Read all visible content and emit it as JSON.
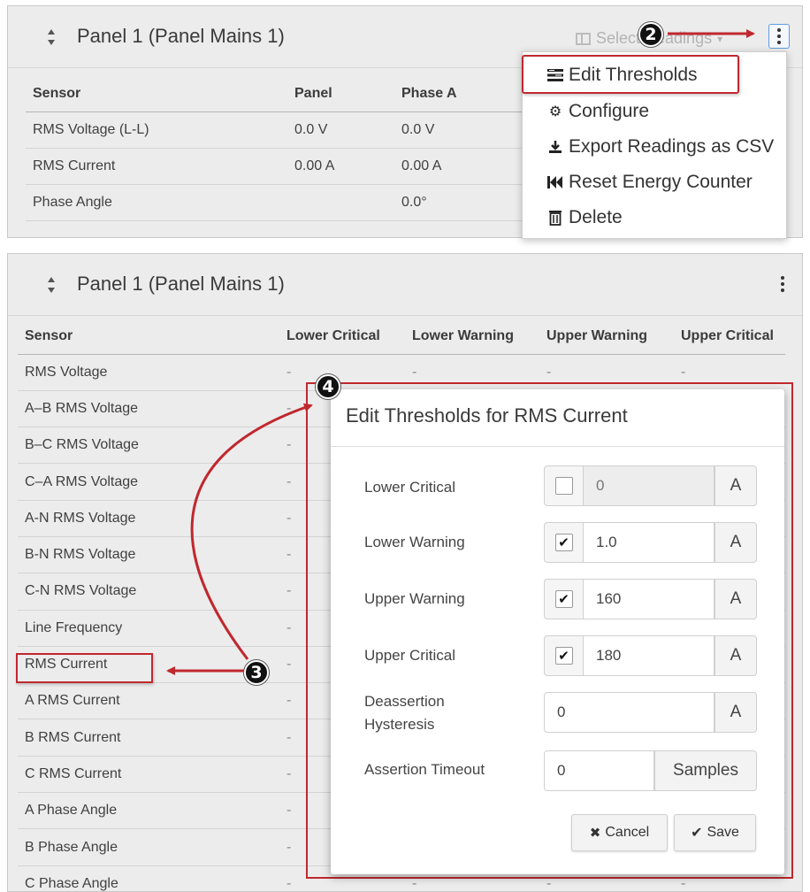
{
  "top_panel": {
    "title": "Panel 1 (Panel Mains 1)",
    "select_readings_label": "Select Readings",
    "columns": [
      "Sensor",
      "Panel",
      "Phase A"
    ],
    "rows": [
      [
        "RMS Voltage (L-L)",
        "0.0 V",
        "0.0 V"
      ],
      [
        "RMS Current",
        "0.00 A",
        "0.00 A"
      ],
      [
        "Phase Angle",
        "",
        "0.0°"
      ]
    ]
  },
  "menu": {
    "items": [
      {
        "label": "Edit Thresholds",
        "icon": "edit-thresholds-icon"
      },
      {
        "label": "Configure",
        "icon": "gear-icon"
      },
      {
        "label": "Export Readings as CSV",
        "icon": "download-icon"
      },
      {
        "label": "Reset Energy Counter",
        "icon": "fast-backward-icon"
      },
      {
        "label": "Delete",
        "icon": "trash-icon"
      }
    ]
  },
  "bottom_panel": {
    "title": "Panel 1 (Panel Mains 1)",
    "columns": [
      "Sensor",
      "Lower Critical",
      "Lower Warning",
      "Upper Warning",
      "Upper Critical"
    ],
    "sensors": [
      "RMS Voltage",
      "A–B RMS Voltage",
      "B–C RMS Voltage",
      "C–A RMS Voltage",
      "A-N RMS Voltage",
      "B-N RMS Voltage",
      "C-N RMS Voltage",
      "Line Frequency",
      "RMS Current",
      "A RMS Current",
      "B RMS Current",
      "C RMS Current",
      "A Phase Angle",
      "B Phase Angle",
      "C Phase Angle"
    ],
    "dash": "-"
  },
  "dialog": {
    "title": "Edit Thresholds for RMS Current",
    "fields": [
      {
        "label": "Lower Critical",
        "checked": false,
        "value": "0",
        "unit": "A"
      },
      {
        "label": "Lower Warning",
        "checked": true,
        "value": "1.0",
        "unit": "A"
      },
      {
        "label": "Upper Warning",
        "checked": true,
        "value": "160",
        "unit": "A"
      },
      {
        "label": "Upper Critical",
        "checked": true,
        "value": "180",
        "unit": "A"
      }
    ],
    "hysteresis": {
      "label_line1": "Deassertion",
      "label_line2": "Hysteresis",
      "value": "0",
      "unit": "A"
    },
    "timeout": {
      "label": "Assertion Timeout",
      "value": "0",
      "unit": "Samples"
    },
    "cancel_label": "Cancel",
    "save_label": "Save",
    "check_mark": "✔"
  },
  "callouts": {
    "two": "2",
    "three": "3",
    "four": "4"
  },
  "colors": {
    "highlight": "#c0282e",
    "panel_bg": "#ececec",
    "accent": "#5f9be3"
  }
}
